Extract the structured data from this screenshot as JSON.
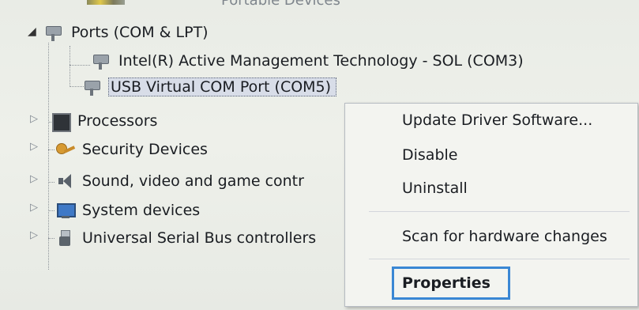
{
  "tree": {
    "partial_top_text": "Portable Devices",
    "ports_label": "Ports (COM & LPT)",
    "children": [
      {
        "label": "Intel(R) Active Management Technology - SOL (COM3)"
      },
      {
        "label": "USB Virtual COM Port (COM5)"
      }
    ],
    "categories": [
      {
        "label": "Processors",
        "icon": "processor-icon"
      },
      {
        "label": "Security Devices",
        "icon": "security-device-icon"
      },
      {
        "label": "Sound, video and game contr",
        "icon": "speaker-icon"
      },
      {
        "label": "System devices",
        "icon": "system-device-icon"
      },
      {
        "label": "Universal Serial Bus controllers",
        "icon": "usb-icon"
      }
    ]
  },
  "context_menu": {
    "items": [
      {
        "label": "Update Driver Software..."
      },
      {
        "label": "Disable"
      },
      {
        "label": "Uninstall"
      },
      {
        "label": "Scan for hardware changes"
      },
      {
        "label": "Properties"
      }
    ],
    "highlighted_item": "Properties",
    "highlight_color": "#3a87d4"
  }
}
